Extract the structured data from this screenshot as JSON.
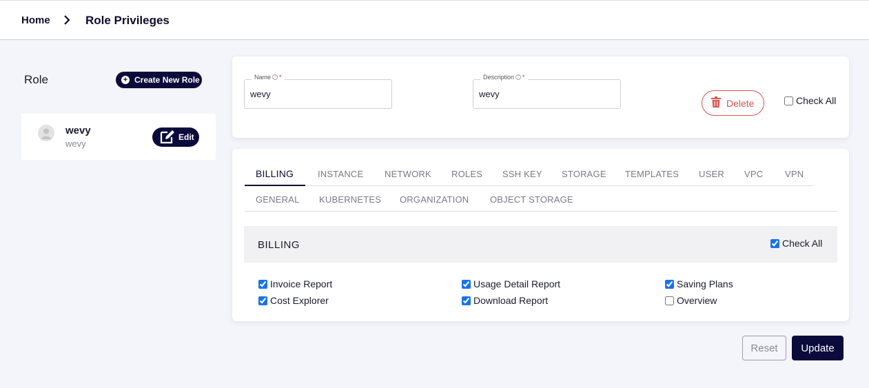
{
  "breadcrumb": {
    "home": "Home",
    "current": "Role Privileges"
  },
  "sidebar": {
    "title": "Role",
    "create_label": "Create New Role",
    "roles": [
      {
        "name": "wevy",
        "description": "wevy",
        "edit_label": "Edit"
      }
    ]
  },
  "form": {
    "name_label": "Name",
    "name_value": "wevy",
    "description_label": "Description",
    "description_value": "wevy",
    "required_mark": "*",
    "delete_label": "Delete",
    "check_all_label": "Check All"
  },
  "tabs": {
    "row1": [
      "BILLING",
      "INSTANCE",
      "NETWORK",
      "ROLES",
      "SSH KEY",
      "STORAGE",
      "TEMPLATES",
      "USER",
      "VPC",
      "VPN"
    ],
    "row2": [
      "GENERAL",
      "KUBERNETES",
      "ORGANIZATION",
      "OBJECT STORAGE"
    ],
    "active": "BILLING"
  },
  "section": {
    "title": "BILLING",
    "check_all_label": "Check All",
    "check_all_checked": true,
    "permissions": [
      {
        "label": "Invoice Report",
        "checked": true
      },
      {
        "label": "Usage Detail Report",
        "checked": true
      },
      {
        "label": "Saving Plans",
        "checked": true
      },
      {
        "label": "Cost Explorer",
        "checked": true
      },
      {
        "label": "Download Report",
        "checked": true
      },
      {
        "label": "Overview",
        "checked": false
      }
    ]
  },
  "actions": {
    "reset_label": "Reset",
    "update_label": "Update"
  },
  "colors": {
    "primary": "#0b0b3b",
    "danger": "#d9534f",
    "background": "#f4f4fb"
  }
}
